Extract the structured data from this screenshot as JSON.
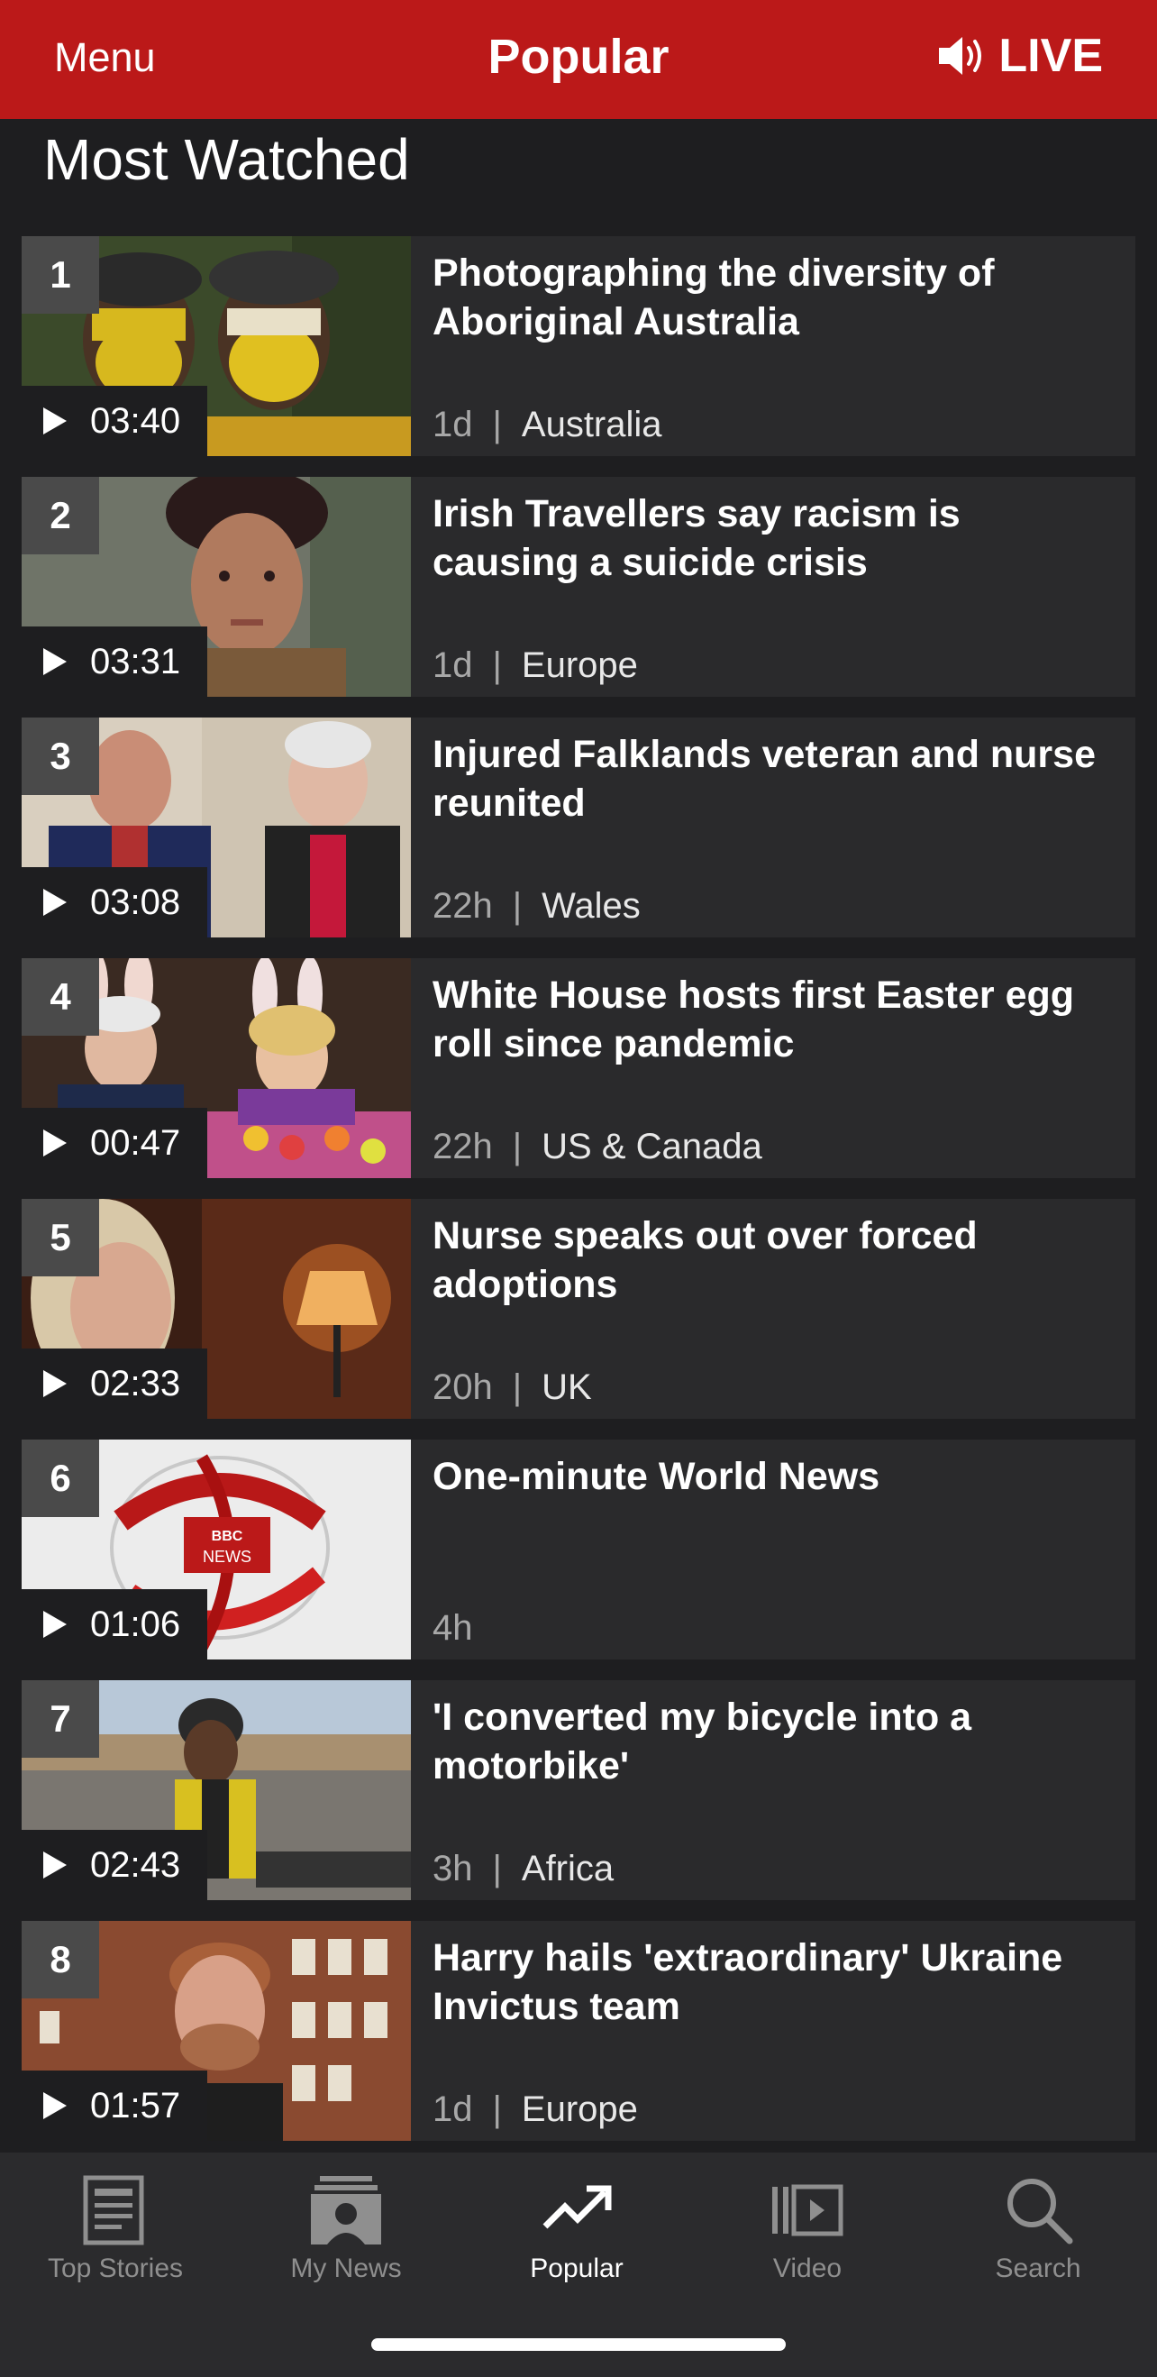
{
  "header": {
    "menu_label": "Menu",
    "title": "Popular",
    "live_label": "LIVE",
    "bg_color": "#bb1919"
  },
  "section_title": "Most Watched",
  "items": [
    {
      "rank": "1",
      "duration": "03:40",
      "headline": "Photographing the diversity of Aboriginal Australia",
      "age": "1d",
      "section": "Australia",
      "thumb_icon": "aboriginal-faces-thumbnail"
    },
    {
      "rank": "2",
      "duration": "03:31",
      "headline": "Irish Travellers say racism is causing a suicide crisis",
      "age": "1d",
      "section": "Europe",
      "thumb_icon": "woman-portrait-thumbnail"
    },
    {
      "rank": "3",
      "duration": "03:08",
      "headline": "Injured Falklands veteran and nurse reunited",
      "age": "22h",
      "section": "Wales",
      "thumb_icon": "veteran-nurse-thumbnail"
    },
    {
      "rank": "4",
      "duration": "00:47",
      "headline": "White House hosts first Easter egg roll since pandemic",
      "age": "22h",
      "section": "US & Canada",
      "thumb_icon": "easter-bunny-thumbnail"
    },
    {
      "rank": "5",
      "duration": "02:33",
      "headline": "Nurse speaks out over forced adoptions",
      "age": "20h",
      "section": "UK",
      "thumb_icon": "nurse-lamp-thumbnail"
    },
    {
      "rank": "6",
      "duration": "01:06",
      "headline": "One-minute World News",
      "age": "4h",
      "section": "",
      "thumb_icon": "bbc-news-globe-thumbnail"
    },
    {
      "rank": "7",
      "duration": "02:43",
      "headline": "'I converted my bicycle into a motorbike'",
      "age": "3h",
      "section": "Africa",
      "thumb_icon": "bicycle-motorbike-thumbnail"
    },
    {
      "rank": "8",
      "duration": "01:57",
      "headline": "Harry hails 'extraordinary' Ukraine Invictus team",
      "age": "1d",
      "section": "Europe",
      "thumb_icon": "prince-harry-thumbnail"
    }
  ],
  "bbc_logo_text": "BBC NEWS",
  "nav": {
    "items": [
      {
        "label": "Top Stories",
        "icon": "newspaper-icon"
      },
      {
        "label": "My News",
        "icon": "my-news-icon"
      },
      {
        "label": "Popular",
        "icon": "trending-icon",
        "active": true
      },
      {
        "label": "Video",
        "icon": "video-icon"
      },
      {
        "label": "Search",
        "icon": "search-icon"
      }
    ]
  }
}
